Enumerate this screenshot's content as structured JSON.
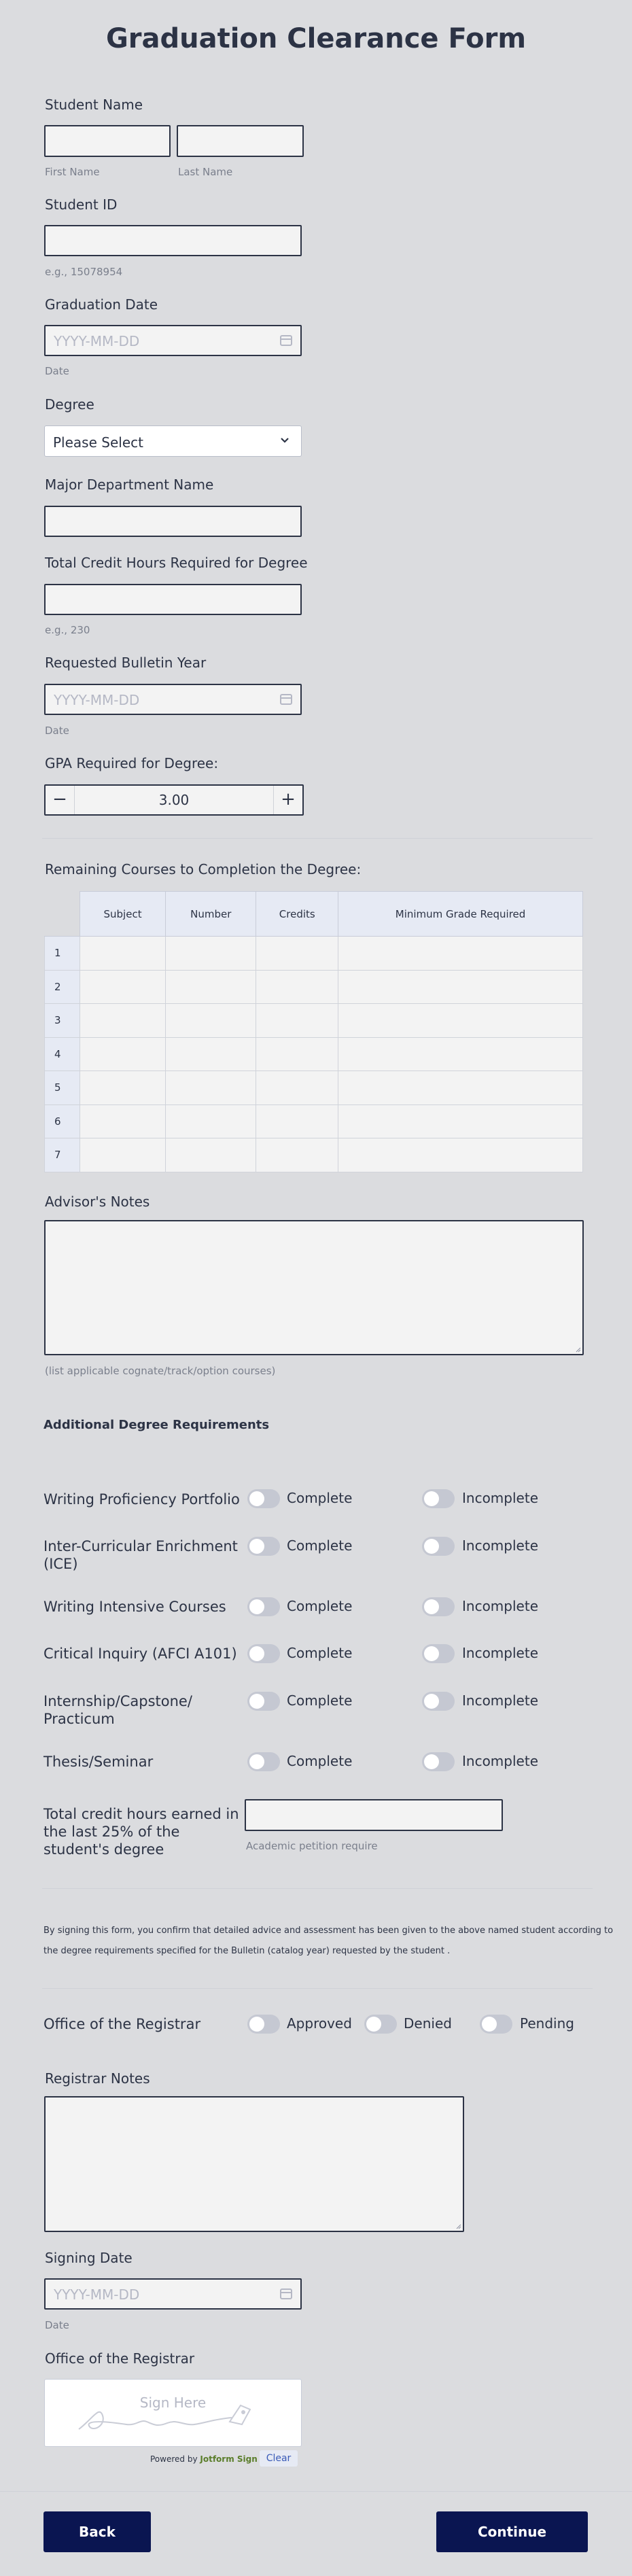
{
  "form": {
    "title": "Graduation Clearance Form"
  },
  "student_name": {
    "label": "Student Name",
    "first_sub": "First Name",
    "last_sub": "Last Name",
    "first_value": "",
    "last_value": ""
  },
  "student_id": {
    "label": "Student ID",
    "value": "",
    "sub": "e.g., 15078954"
  },
  "graduation_date": {
    "label": "Graduation Date",
    "placeholder": "YYYY-MM-DD",
    "sub": "Date"
  },
  "degree": {
    "label": "Degree",
    "selected": "Please Select"
  },
  "major": {
    "label": "Major Department Name",
    "value": ""
  },
  "credit_hours": {
    "label": "Total Credit Hours Required for Degree",
    "value": "",
    "sub": "e.g., 230"
  },
  "bulletin_year": {
    "label": "Requested Bulletin Year",
    "placeholder": "YYYY-MM-DD",
    "sub": "Date"
  },
  "gpa": {
    "label": "GPA Required for Degree:",
    "value": "3.00",
    "minus": "−",
    "plus": "+"
  },
  "courses": {
    "label": "Remaining Courses to Completion the Degree:",
    "columns": [
      "Subject",
      "Number",
      "Credits",
      "Minimum Grade Required"
    ],
    "rows": [
      "1",
      "2",
      "3",
      "4",
      "5",
      "6",
      "7"
    ]
  },
  "advisor_notes": {
    "label": "Advisor's Notes",
    "value": "",
    "sub": "(list applicable cognate/track/option courses)"
  },
  "additional": {
    "heading": "Additional Degree Requirements",
    "complete_label": "Complete",
    "incomplete_label": "Incomplete",
    "items": [
      {
        "label": "Writing Proficiency Portfolio"
      },
      {
        "label": "Inter-Curricular Enrichment (ICE)"
      },
      {
        "label": "Writing Intensive Courses"
      },
      {
        "label": "Critical Inquiry (AFCI A101)"
      },
      {
        "label": "Internship/Capstone/ Practicum"
      },
      {
        "label": "Thesis/Seminar"
      }
    ]
  },
  "last25": {
    "label": "Total credit hours earned in the last 25% of the student's degree",
    "value": "",
    "sub": "Academic petition require"
  },
  "disclaimer": {
    "line1": "By signing this form, you confirm that detailed advice and assessment has been given to the above named student according to",
    "line2": "the degree requirements specified for the Bulletin (catalog year) requested by the student ."
  },
  "registrar": {
    "label": "Office of the Registrar",
    "options": [
      "Approved",
      "Denied",
      "Pending"
    ]
  },
  "registrar_notes": {
    "label": "Registrar Notes",
    "value": ""
  },
  "signing_date": {
    "label": "Signing Date",
    "placeholder": "YYYY-MM-DD",
    "sub": "Date"
  },
  "signature": {
    "label": "Office of the Registrar",
    "placeholder": "Sign Here",
    "powered": "Powered by",
    "brand": "Jotform Sign",
    "clear": "Clear"
  },
  "nav": {
    "back": "Back",
    "continue": "Continue"
  },
  "colors": {
    "primary": "#0a1551",
    "text": "#2c3345",
    "background": "#dbdcdf",
    "input_bg": "#f3f3f3",
    "header_cell": "#e6eaf4",
    "toggle_off": "#c5c8d2"
  }
}
